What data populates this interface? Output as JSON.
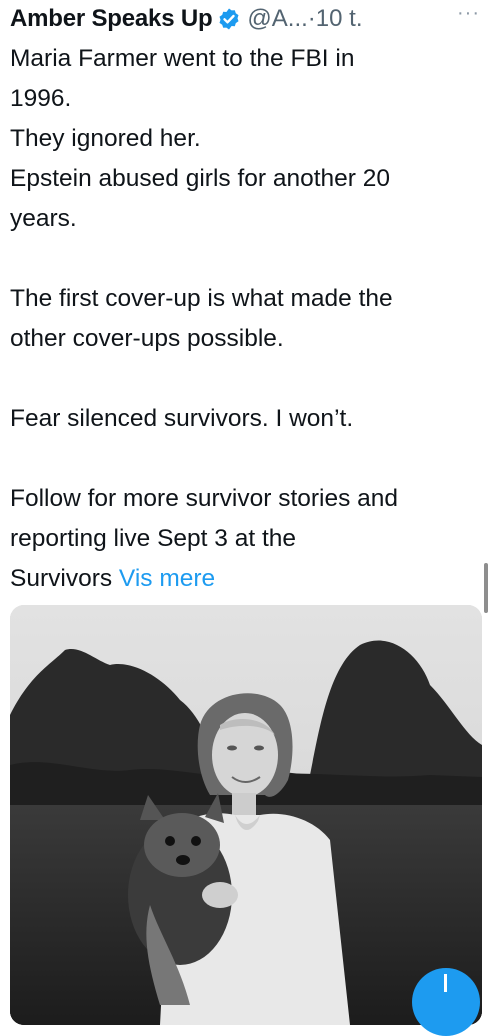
{
  "tweet": {
    "author_name": "Amber Speaks Up",
    "handle_time": "@A...·10 t.",
    "more_label": "···",
    "lines": [
      "Maria Farmer went to the FBI in",
      "1996.",
      "They ignored her.",
      "Epstein abused girls for another 20",
      "years.",
      "",
      "The first cover-up is what made the",
      "other cover-ups possible.",
      "",
      "Fear silenced survivors. I won’t.",
      "",
      "Follow for more survivor stories and",
      "reporting live Sept 3 at the"
    ],
    "last_line_text": "Survivors",
    "show_more": "Vis mere"
  },
  "icons": {
    "verified": "verified-badge-icon",
    "compose": "compose-plus-icon"
  },
  "colors": {
    "link": "#1d9bf0",
    "verified": "#1d9bf0",
    "secondary_text": "#536471"
  }
}
